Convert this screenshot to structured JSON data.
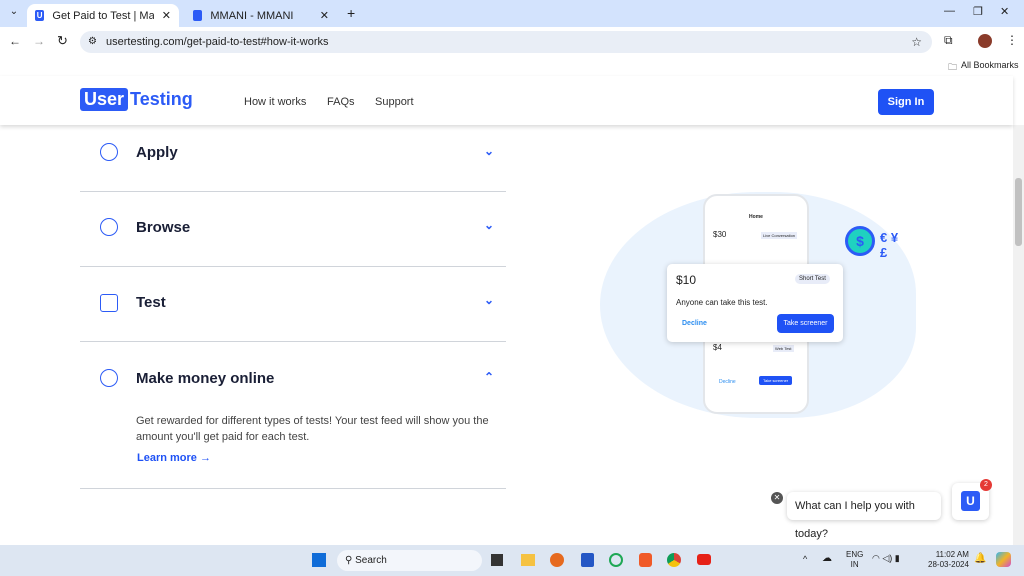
{
  "browser": {
    "tabs": [
      {
        "title": "Get Paid to Test | Make Money",
        "active": true
      },
      {
        "title": "MMANI - MMANI",
        "active": false
      }
    ],
    "url": "usertesting.com/get-paid-to-test#how-it-works",
    "bookmarks_label": "All Bookmarks"
  },
  "header": {
    "logo": {
      "part1": "User",
      "part2": "Testing"
    },
    "nav": [
      "How it works",
      "FAQs",
      "Support"
    ],
    "signin": "Sign In",
    "accent": "#1f52f5"
  },
  "accordion": [
    {
      "label": "Apply",
      "icon": "target-icon",
      "expanded": false
    },
    {
      "label": "Browse",
      "icon": "browse-icon",
      "expanded": false
    },
    {
      "label": "Test",
      "icon": "test-icon",
      "expanded": false
    },
    {
      "label": "Make money online",
      "icon": "money-icon",
      "expanded": true,
      "description": "Get rewarded for different types of tests! Your test feed will show you the amount you'll get paid for each test.",
      "link": "Learn more"
    }
  ],
  "illustration": {
    "phone_title": "Home",
    "card1": {
      "price": "$30",
      "tag": "Live Conversation"
    },
    "card_main": {
      "price": "$10",
      "tag": "Short Test",
      "text": "Anyone can take this test.",
      "decline": "Decline",
      "action": "Take screener"
    },
    "card2": {
      "price": "$4",
      "tag": "Web Test",
      "decline": "Decline",
      "action": "Take screener"
    }
  },
  "chat": {
    "prompt": "What can I help you with today?",
    "badge": "2"
  },
  "taskbar": {
    "search": "Search",
    "lang1": "ENG",
    "lang2": "IN",
    "time": "11:02 AM",
    "date": "28-03-2024"
  }
}
